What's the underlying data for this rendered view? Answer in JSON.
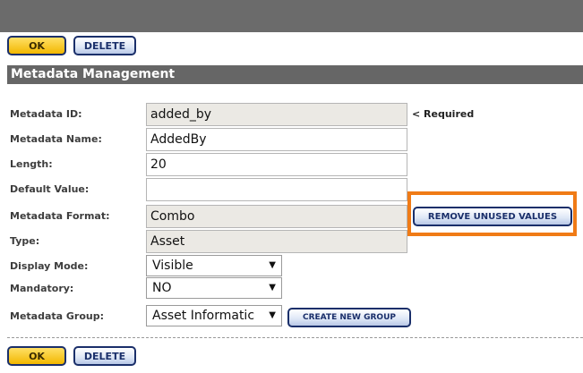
{
  "toolbar": {
    "ok_label": "OK",
    "delete_label": "DELETE"
  },
  "section": {
    "title": "Metadata Management"
  },
  "form": {
    "metadata_id": {
      "label": "Metadata ID:",
      "value": "added_by",
      "note": "< Required"
    },
    "metadata_name": {
      "label": "Metadata Name:",
      "value": "AddedBy"
    },
    "length": {
      "label": "Length:",
      "value": "20"
    },
    "default_value": {
      "label": "Default Value:",
      "value": ""
    },
    "metadata_format": {
      "label": "Metadata Format:",
      "value": "Combo",
      "action_label": "REMOVE UNUSED VALUES"
    },
    "type": {
      "label": "Type:",
      "value": "Asset"
    },
    "display_mode": {
      "label": "Display Mode:",
      "selected": "Visible"
    },
    "mandatory": {
      "label": "Mandatory:",
      "selected": "NO"
    },
    "metadata_group": {
      "label": "Metadata Group:",
      "selected": "Asset Informatic",
      "action_label": "CREATE NEW GROUP"
    }
  },
  "footer": {
    "ok_label": "OK",
    "delete_label": "DELETE"
  },
  "icons": {
    "dropdown": "dropdown-arrow-icon"
  },
  "colors": {
    "ok_button": "#f2b700",
    "highlight_border": "#f07b16",
    "header_bar": "#666666",
    "button_border": "#1a2f6a"
  }
}
